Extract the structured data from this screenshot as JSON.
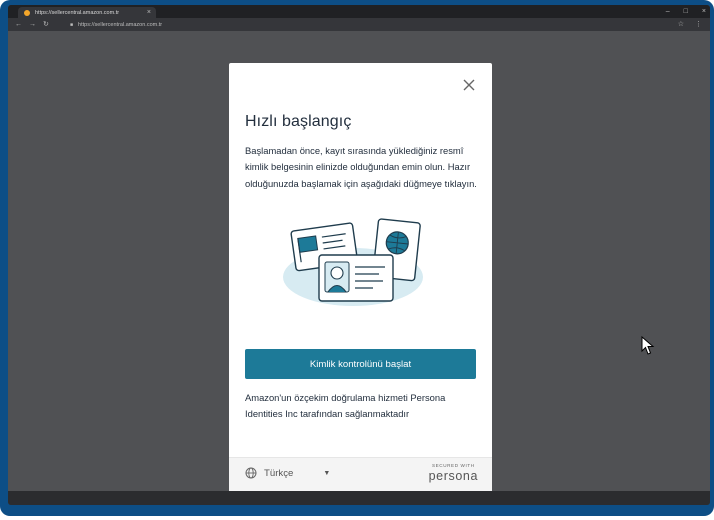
{
  "browser": {
    "tab_title": "https://sellercentral.amazon.com.tr",
    "url": "https://sellercentral.amazon.com.tr",
    "window_controls": [
      "–",
      "□",
      "×"
    ]
  },
  "modal": {
    "title": "Hızlı başlangıç",
    "description": "Başlamadan önce, kayıt sırasında yüklediğiniz resmî kimlik belgesinin elinizde olduğundan emin olun. Hazır olduğunuzda başlamak için aşağıdaki düğmeye tıklayın.",
    "cta_label": "Kimlik kontrolünü başlat",
    "footer_note": "Amazon'un özçekim doğrulama hizmeti Persona Identities Inc tarafından sağlanmaktadır",
    "language": "Türkçe",
    "secured_with": "SECURED WITH",
    "brand": "persona"
  },
  "icons": [
    "close-icon",
    "globe-icon",
    "caret-down-icon",
    "id-cards-illustration",
    "mouse-cursor-icon"
  ],
  "colors": {
    "cta": "#1d7a98",
    "frame": "#0d4e86",
    "page_bg": "#505154",
    "text": "#232f3e"
  }
}
